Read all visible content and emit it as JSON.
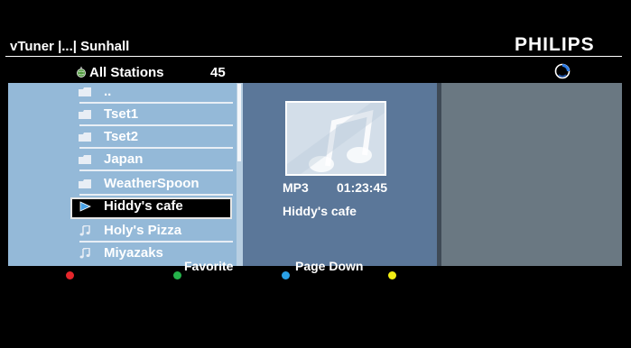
{
  "header": {
    "title": "vTuner |...| Sunhall",
    "brand": "PHILIPS"
  },
  "list": {
    "title": "All Stations",
    "count": "45",
    "items": [
      {
        "label": "..",
        "icon": "folder-icon"
      },
      {
        "label": "Tset1",
        "icon": "folder-icon"
      },
      {
        "label": "Tset2",
        "icon": "folder-icon"
      },
      {
        "label": "Japan",
        "icon": "folder-icon"
      },
      {
        "label": "WeatherSpoon",
        "icon": "folder-icon"
      },
      {
        "label": "Hiddy's cafe",
        "icon": "play-icon",
        "selected": true
      },
      {
        "label": "Holy's Pizza",
        "icon": "music-note-icon"
      },
      {
        "label": "Miyazaks",
        "icon": "music-note-icon"
      }
    ]
  },
  "details": {
    "format": "MP3",
    "duration": "01:23:45",
    "name": "Hiddy's cafe"
  },
  "footer": {
    "buttons": [
      {
        "color": "#e5262b",
        "label": ""
      },
      {
        "color": "#25b34b",
        "label": "Favorite"
      },
      {
        "color": "#2aa0e6",
        "label": "Page Down"
      },
      {
        "color": "#f3ee14",
        "label": ""
      }
    ]
  }
}
